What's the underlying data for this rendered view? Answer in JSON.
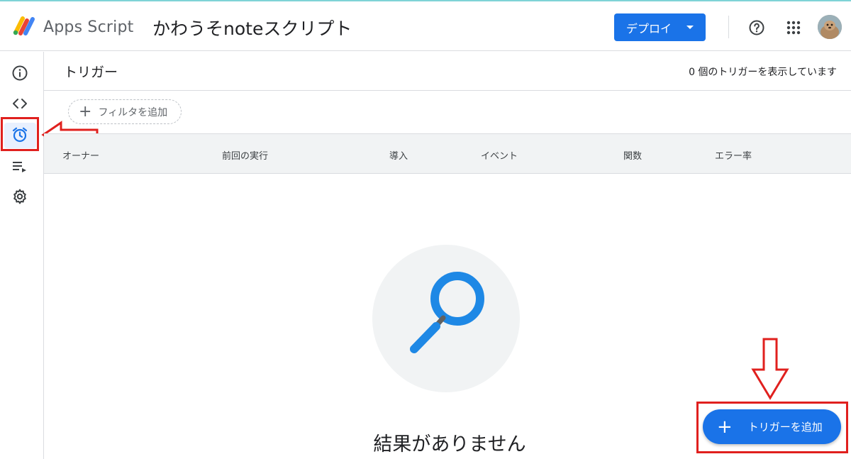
{
  "app": {
    "brand": "Apps Script",
    "project_title": "かわうそnoteスクリプト"
  },
  "header": {
    "deploy_label": "デプロイ",
    "help_icon": "help-circle-icon",
    "apps_icon": "google-apps-grid-icon",
    "avatar_icon": "user-avatar"
  },
  "rail": {
    "items": [
      {
        "name": "overview",
        "icon": "info-icon"
      },
      {
        "name": "editor",
        "icon": "code-icon"
      },
      {
        "name": "triggers",
        "icon": "alarm-clock-icon",
        "active": true
      },
      {
        "name": "executions",
        "icon": "list-play-icon"
      },
      {
        "name": "settings",
        "icon": "gear-icon"
      }
    ]
  },
  "main": {
    "title": "トリガー",
    "count_text": "0 個のトリガーを表示しています",
    "filter_label": "フィルタを追加",
    "columns": [
      "オーナー",
      "前回の実行",
      "導入",
      "イベント",
      "関数",
      "エラー率"
    ],
    "empty_text": "結果がありません",
    "fab_label": "トリガーを追加"
  },
  "colors": {
    "primary": "#1a73e8",
    "annotation_red": "#e0201e",
    "search_icon_blue": "#1e88e5"
  }
}
